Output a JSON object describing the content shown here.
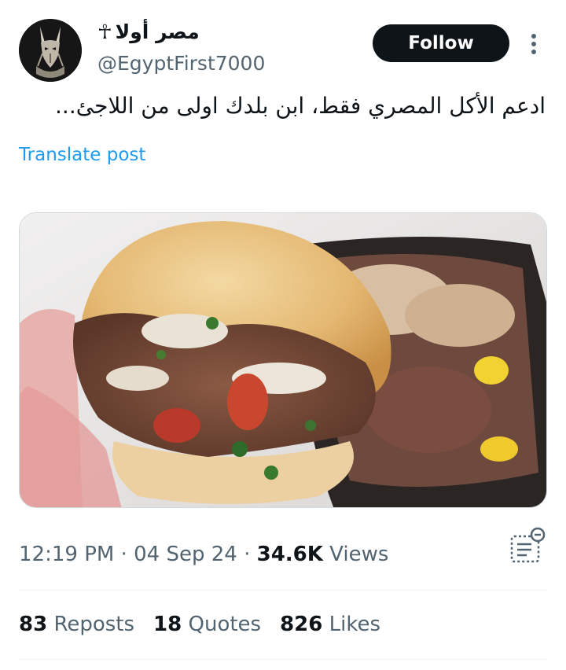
{
  "author": {
    "display_name": "مصر أولا",
    "name_emoji": "☥",
    "handle": "@EgyptFirst7000",
    "avatar_icon": "anubis-avatar"
  },
  "header": {
    "follow_label": "Follow",
    "more_icon": "more-vertical-icon"
  },
  "post": {
    "text": "ادعم الأكل المصري فقط، ابن بلدك اولى من اللاجئ...",
    "translate_label": "Translate post",
    "media_description_icon": "sandwich-photo"
  },
  "meta": {
    "time": "12:19 PM",
    "separator": "·",
    "date": "04 Sep 24",
    "views_count": "34.6K",
    "views_label": "Views"
  },
  "stats": {
    "reposts_count": "83",
    "reposts_label": "Reposts",
    "quotes_count": "18",
    "quotes_label": "Quotes",
    "likes_count": "826",
    "likes_label": "Likes"
  },
  "colors": {
    "accent": "#1d9bf0",
    "primary_text": "#0f1419",
    "secondary_text": "#536471",
    "follow_bg": "#0f1419"
  }
}
